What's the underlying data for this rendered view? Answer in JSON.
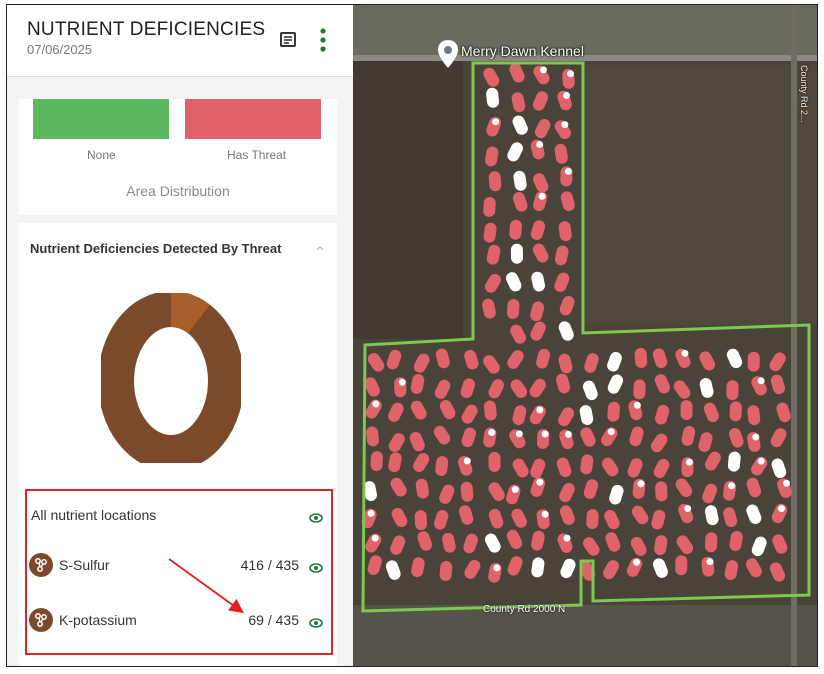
{
  "header": {
    "title": "NUTRIENT DEFICIENCIES",
    "date": "07/06/2025"
  },
  "area_distribution": {
    "none_label": "None",
    "threat_label": "Has Threat",
    "title": "Area Distribution"
  },
  "threat_card": {
    "title": "Nutrient Deficiencies Detected By Threat"
  },
  "legend": {
    "all_label": "All nutrient locations",
    "items": [
      {
        "label": "S-Sulfur",
        "count": "416 / 435"
      },
      {
        "label": "K-potassium",
        "count": "69 / 435"
      }
    ]
  },
  "map": {
    "pin_label": "Merry Dawn Kennel",
    "road_label": "County Rd 2000 N",
    "road_vertical_label": "County Rd 2..."
  },
  "colors": {
    "brown": "#7a4a2a",
    "green": "#5cb85c",
    "red": "#e0626a",
    "boundary": "#7ec850"
  },
  "icons": {
    "notes": "notes-icon",
    "more": "more-vertical-icon",
    "eye": "eye-icon",
    "nutrient": "molecule-icon",
    "pin": "map-pin-icon"
  }
}
